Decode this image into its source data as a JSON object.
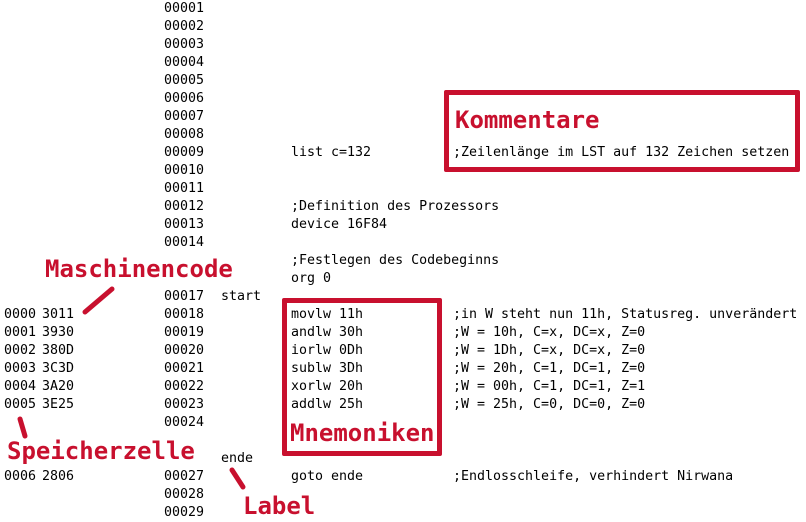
{
  "rows": [
    {
      "addr": "",
      "code": "",
      "line": "00001",
      "label": "",
      "instr": "",
      "comment": ""
    },
    {
      "addr": "",
      "code": "",
      "line": "00002",
      "label": "",
      "instr": "",
      "comment": ""
    },
    {
      "addr": "",
      "code": "",
      "line": "00003",
      "label": "",
      "instr": "",
      "comment": ""
    },
    {
      "addr": "",
      "code": "",
      "line": "00004",
      "label": "",
      "instr": "",
      "comment": ""
    },
    {
      "addr": "",
      "code": "",
      "line": "00005",
      "label": "",
      "instr": "",
      "comment": ""
    },
    {
      "addr": "",
      "code": "",
      "line": "00006",
      "label": "",
      "instr": "",
      "comment": ""
    },
    {
      "addr": "",
      "code": "",
      "line": "00007",
      "label": "",
      "instr": "",
      "comment": ""
    },
    {
      "addr": "",
      "code": "",
      "line": "00008",
      "label": "",
      "instr": "",
      "comment": ""
    },
    {
      "addr": "",
      "code": "",
      "line": "00009",
      "label": "",
      "instr": "list c=132",
      "comment": ";Zeilenlänge im LST auf 132 Zeichen setzen"
    },
    {
      "addr": "",
      "code": "",
      "line": "00010",
      "label": "",
      "instr": "",
      "comment": ""
    },
    {
      "addr": "",
      "code": "",
      "line": "00011",
      "label": "",
      "instr": "",
      "comment": ""
    },
    {
      "addr": "",
      "code": "",
      "line": "00012",
      "label": "",
      "instr": ";Definition des Prozessors",
      "comment": ""
    },
    {
      "addr": "",
      "code": "",
      "line": "00013",
      "label": "",
      "instr": "device 16F84",
      "comment": ""
    },
    {
      "addr": "",
      "code": "",
      "line": "00014",
      "label": "",
      "instr": "",
      "comment": ""
    },
    {
      "addr": "",
      "code": "",
      "line": "",
      "label": "",
      "instr": ";Festlegen des Codebeginns",
      "comment": ""
    },
    {
      "addr": "",
      "code": "",
      "line": "",
      "label": "",
      "instr": "org 0",
      "comment": ""
    },
    {
      "addr": "",
      "code": "",
      "line": "00017",
      "label": "start",
      "instr": "",
      "comment": ""
    },
    {
      "addr": "0000",
      "code": "3011",
      "line": "00018",
      "label": "",
      "instr": "movlw 11h",
      "comment": ";in W steht nun 11h, Statusreg. unverändert"
    },
    {
      "addr": "0001",
      "code": "3930",
      "line": "00019",
      "label": "",
      "instr": "andlw 30h",
      "comment": ";W = 10h, C=x, DC=x, Z=0"
    },
    {
      "addr": "0002",
      "code": "380D",
      "line": "00020",
      "label": "",
      "instr": "iorlw 0Dh",
      "comment": ";W = 1Dh, C=x, DC=x, Z=0"
    },
    {
      "addr": "0003",
      "code": "3C3D",
      "line": "00021",
      "label": "",
      "instr": "sublw 3Dh",
      "comment": ";W = 20h, C=1, DC=1, Z=0"
    },
    {
      "addr": "0004",
      "code": "3A20",
      "line": "00022",
      "label": "",
      "instr": "xorlw 20h",
      "comment": ";W = 00h, C=1, DC=1, Z=1"
    },
    {
      "addr": "0005",
      "code": "3E25",
      "line": "00023",
      "label": "",
      "instr": "addlw 25h",
      "comment": ";W = 25h, C=0, DC=0, Z=0"
    },
    {
      "addr": "",
      "code": "",
      "line": "00024",
      "label": "",
      "instr": "",
      "comment": ""
    },
    {
      "addr": "",
      "code": "",
      "line": "",
      "label": "",
      "instr": "",
      "comment": ""
    },
    {
      "addr": "",
      "code": "",
      "line": "",
      "label": "ende",
      "instr": "",
      "comment": ""
    },
    {
      "addr": "0006",
      "code": "2806",
      "line": "00027",
      "label": "",
      "instr": "goto ende",
      "comment": ";Endlosschleife, verhindert Nirwana"
    },
    {
      "addr": "",
      "code": "",
      "line": "00028",
      "label": "",
      "instr": "",
      "comment": ""
    },
    {
      "addr": "",
      "code": "",
      "line": "00029",
      "label": "",
      "instr": "",
      "comment": ""
    }
  ],
  "annotations": {
    "kommentare": "Kommentare",
    "maschinencode": "Maschinencode",
    "mnemoniken": "Mnemoniken",
    "speicherzelle": "Speicherzelle",
    "label": "Label"
  },
  "colors": {
    "accent": "#c8102e",
    "text": "#000000",
    "background": "#ffffff"
  }
}
